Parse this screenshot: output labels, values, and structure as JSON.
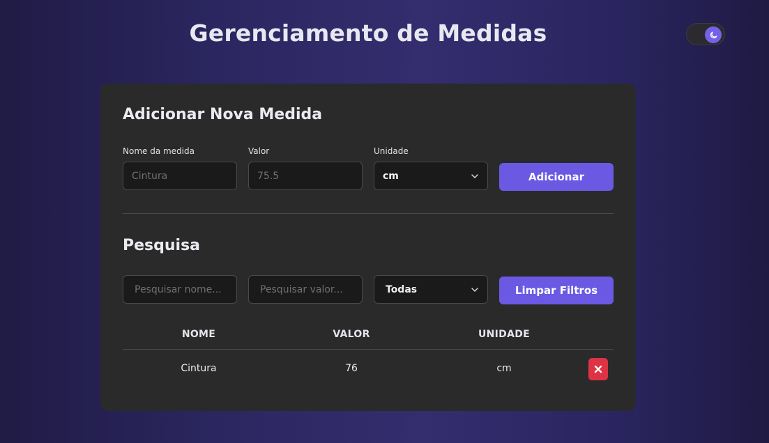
{
  "header": {
    "title": "Gerenciamento de Medidas"
  },
  "theme_toggle": {
    "icon": "moon-icon",
    "accent": "#7561e8"
  },
  "add_section": {
    "title": "Adicionar Nova Medida",
    "name_label": "Nome da medida",
    "name_placeholder": "Cintura",
    "value_label": "Valor",
    "value_placeholder": "75.5",
    "unit_label": "Unidade",
    "unit_selected": "cm",
    "submit_label": "Adicionar"
  },
  "search_section": {
    "title": "Pesquisa",
    "name_placeholder": "Pesquisar nome...",
    "value_placeholder": "Pesquisar valor...",
    "unit_selected": "Todas",
    "clear_label": "Limpar Filtros"
  },
  "table": {
    "headers": [
      "NOME",
      "VALOR",
      "UNIDADE"
    ],
    "rows": [
      {
        "name": "Cintura",
        "value": "76",
        "unit": "cm",
        "delete_icon": "x-icon"
      }
    ]
  },
  "colors": {
    "primary_button": "#6b59e3",
    "danger_button": "#de3344",
    "card_bg": "#2a2a2a"
  }
}
